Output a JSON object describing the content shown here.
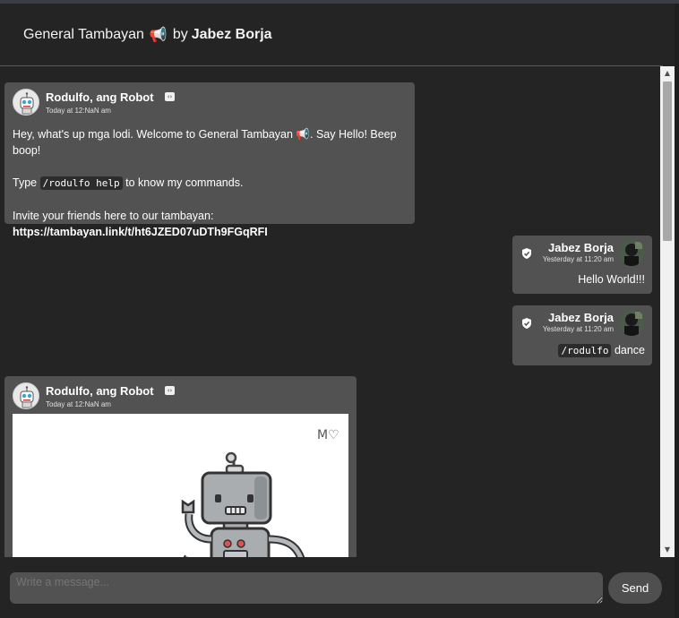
{
  "header": {
    "title": "General Tambayan",
    "title_emoji": "📢",
    "by": "by",
    "author": "Jabez Borja"
  },
  "messages": [
    {
      "author": "Rodulfo, ang Robot",
      "time": "Today at 12:NaN am",
      "badge": "‹›",
      "line1": "Hey, what's up mga lodi. Welcome to General Tambayan 📢. Say Hello! Beep boop!",
      "line2_pre": "Type ",
      "line2_code": "/rodulfo help",
      "line2_post": " to know my commands.",
      "line3": "Invite your friends here to our tambayan:",
      "link": "https://tambayan.link/t/ht6JZED07uDTh9FGqRFI"
    },
    {
      "author": "Jabez Borja",
      "time": "Yesterday at 11:20 am",
      "text": "Hello World!!!"
    },
    {
      "author": "Jabez Borja",
      "time": "Yesterday at 11:20 am",
      "code": "/rodulfo",
      "text": " dance"
    },
    {
      "author": "Rodulfo, ang Robot",
      "time": "Today at 12:NaN am",
      "badge": "‹›",
      "image_signature": "M♡"
    }
  ],
  "composer": {
    "placeholder": "Write a message...",
    "send_label": "Send"
  },
  "colors": {
    "background": "#242424",
    "bubble": "#525252",
    "text": "#ffffff"
  },
  "icons": {
    "shield": "shield-check-icon",
    "bot": "bot-badge-icon",
    "megaphone": "megaphone-icon"
  }
}
